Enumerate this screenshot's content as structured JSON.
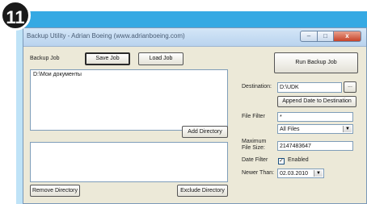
{
  "step_badge": "11",
  "window": {
    "title": "Backup Utility - Adrian Boeing (www.adrianboeing.com)",
    "min_label": "–",
    "max_label": "□",
    "close_label": "x"
  },
  "backup_job": {
    "label": "Backup Job",
    "save_label": "Save Job",
    "load_label": "Load Job",
    "run_label": "Run Backup Job"
  },
  "directories": {
    "items": [
      "D:\\Мои документы"
    ],
    "add_label": "Add Directory",
    "remove_label": "Remove Directory",
    "exclude_label": "Exclude Directory"
  },
  "destination": {
    "label": "Destination:",
    "value": "D:\\UDK",
    "browse_label": "...",
    "append_date_label": "Append Date to Destination"
  },
  "file_filter": {
    "label": "File Filter",
    "value": "*",
    "selected": "All Files"
  },
  "max_file_size": {
    "label_line1": "Maximum",
    "label_line2": "File Size:",
    "value": "2147483647"
  },
  "date_filter": {
    "label": "Date Filter",
    "check_mark": "✓",
    "enabled_label": "Enabled"
  },
  "newer_than": {
    "label": "Newer Than:",
    "value": "02.03.2010"
  },
  "colors": {
    "accent_stripe": "#35a9e3",
    "window_bg": "#ece9d8",
    "close_button": "#c7432a"
  }
}
